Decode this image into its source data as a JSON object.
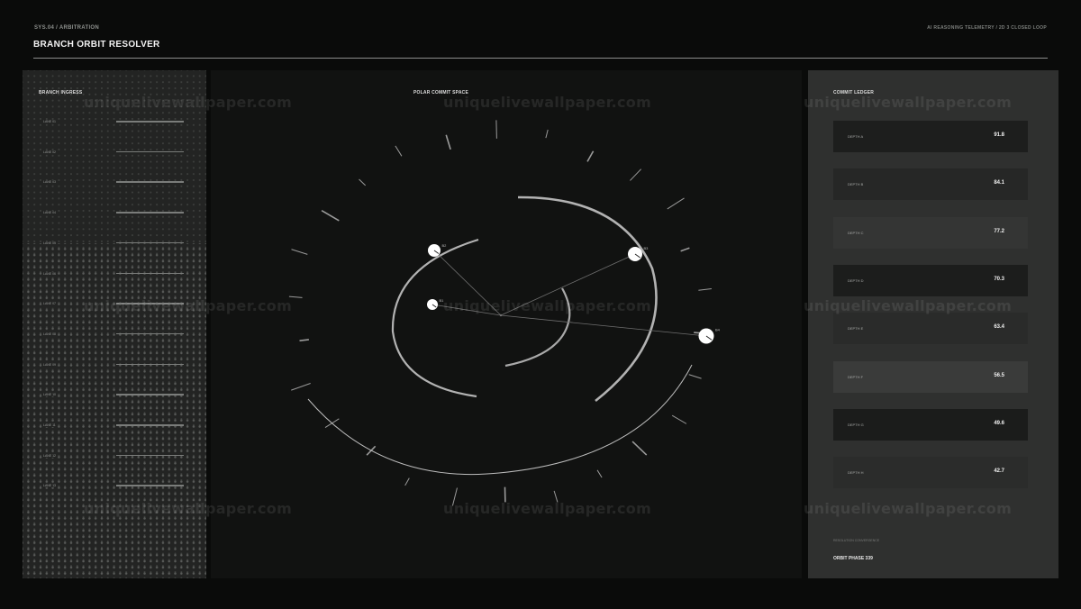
{
  "header": {
    "breadcrumb": "SYS.04 / ARBITRATION",
    "telemetry": "AI REASONING TELEMETRY / 2D 3 CLOSED LOOP",
    "title": "BRANCH ORBIT RESOLVER"
  },
  "ingress": {
    "title": "BRANCH INGRESS",
    "rows": [
      {
        "label": "LANE 01",
        "level": 1.0
      },
      {
        "label": "LANE 02",
        "level": 1.0
      },
      {
        "label": "LANE 03",
        "level": 1.0
      },
      {
        "label": "LANE 04",
        "level": 1.0
      },
      {
        "label": "LANE 05",
        "level": 1.0
      },
      {
        "label": "LANE 06",
        "level": 1.0
      },
      {
        "label": "LANE 07",
        "level": 1.0
      },
      {
        "label": "LANE 08",
        "level": 1.0
      },
      {
        "label": "LANE 09",
        "level": 1.0
      },
      {
        "label": "LANE 10",
        "level": 1.0
      },
      {
        "label": "LANE 11",
        "level": 1.0
      },
      {
        "label": "LANE 12",
        "level": 1.0
      },
      {
        "label": "LANE 13",
        "level": 1.0
      }
    ]
  },
  "polar": {
    "title": "POLAR COMMIT SPACE",
    "nodes": [
      {
        "label": "B2"
      },
      {
        "label": "B1"
      },
      {
        "label": "B3"
      },
      {
        "label": "B4"
      }
    ]
  },
  "ledger": {
    "title": "COMMIT LEDGER",
    "rows": [
      {
        "name": "DEPTH A",
        "value": "91.8"
      },
      {
        "name": "DEPTH B",
        "value": "84.1"
      },
      {
        "name": "DEPTH C",
        "value": "77.2"
      },
      {
        "name": "DEPTH D",
        "value": "70.3"
      },
      {
        "name": "DEPTH E",
        "value": "63.4"
      },
      {
        "name": "DEPTH F",
        "value": "56.5"
      },
      {
        "name": "DEPTH G",
        "value": "49.6"
      },
      {
        "name": "DEPTH H",
        "value": "42.7"
      }
    ],
    "footnote": "RESOLUTION CONVERGENCE",
    "phase": "ORBIT PHASE 339"
  },
  "watermark": "uniquelivewallpaper.com",
  "colors": {
    "background": "#0a0b0a",
    "accent": "#ffffff"
  }
}
